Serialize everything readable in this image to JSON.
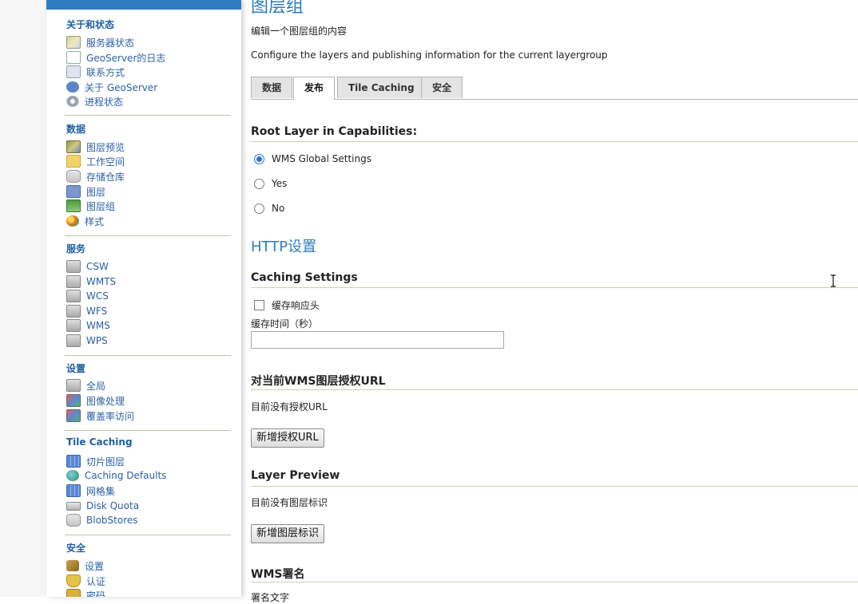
{
  "sidebar": {
    "sections": [
      {
        "title": "关于和状态",
        "items": [
          {
            "label": "服务器状态",
            "icon": "chart-icon"
          },
          {
            "label": "GeoServer的日志",
            "icon": "document-icon"
          },
          {
            "label": "联系方式",
            "icon": "contact-card-icon"
          },
          {
            "label": "关于 GeoServer",
            "icon": "help-icon"
          },
          {
            "label": "进程状态",
            "icon": "gear-icon"
          }
        ]
      },
      {
        "title": "数据",
        "items": [
          {
            "label": "图层预览",
            "icon": "map-preview-icon"
          },
          {
            "label": "工作空间",
            "icon": "folder-icon"
          },
          {
            "label": "存储仓库",
            "icon": "database-icon"
          },
          {
            "label": "图层",
            "icon": "layer-icon"
          },
          {
            "label": "图层组",
            "icon": "layer-group-icon"
          },
          {
            "label": "样式",
            "icon": "style-palette-icon"
          }
        ]
      },
      {
        "title": "服务",
        "items": [
          {
            "label": "CSW",
            "icon": "server-icon"
          },
          {
            "label": "WMTS",
            "icon": "server-icon"
          },
          {
            "label": "WCS",
            "icon": "server-icon"
          },
          {
            "label": "WFS",
            "icon": "server-icon"
          },
          {
            "label": "WMS",
            "icon": "server-icon"
          },
          {
            "label": "WPS",
            "icon": "server-icon"
          }
        ]
      },
      {
        "title": "设置",
        "items": [
          {
            "label": "全局",
            "icon": "server-icon"
          },
          {
            "label": "图像处理",
            "icon": "image-processing-icon"
          },
          {
            "label": "覆盖率访问",
            "icon": "image-processing-icon"
          }
        ]
      },
      {
        "title": "Tile Caching",
        "items": [
          {
            "label": "切片图层",
            "icon": "grid-icon"
          },
          {
            "label": "Caching Defaults",
            "icon": "globe-icon"
          },
          {
            "label": "网格集",
            "icon": "grid-icon"
          },
          {
            "label": "Disk Quota",
            "icon": "disk-icon"
          },
          {
            "label": "BlobStores",
            "icon": "database-icon"
          }
        ]
      },
      {
        "title": "安全",
        "items": [
          {
            "label": "设置",
            "icon": "key-icon"
          },
          {
            "label": "认证",
            "icon": "shield-icon"
          },
          {
            "label": "密码",
            "icon": "lock-icon"
          }
        ]
      }
    ]
  },
  "main": {
    "title": "图层组",
    "subtitle_cn": "编辑一个图层组的内容",
    "subtitle_en": "Configure the layers and publishing information for the current layergroup",
    "tabs": [
      {
        "label": "数据",
        "active": false
      },
      {
        "label": "发布",
        "active": true
      },
      {
        "label": "Tile Caching",
        "active": false
      },
      {
        "label": "安全",
        "active": false
      }
    ],
    "root_layer": {
      "heading": "Root Layer in Capabilities:",
      "options": [
        {
          "label": "WMS Global Settings",
          "checked": true
        },
        {
          "label": "Yes",
          "checked": false
        },
        {
          "label": "No",
          "checked": false
        }
      ]
    },
    "http": {
      "title": "HTTP设置",
      "caching_heading": "Caching Settings",
      "cache_checkbox_label": "缓存响应头",
      "cache_time_label": "缓存时间（秒）",
      "cache_time_value": ""
    },
    "auth_url": {
      "heading": "对当前WMS图层授权URL",
      "empty_text": "目前没有授权URL",
      "add_button": "新增授权URL"
    },
    "layer_preview": {
      "heading": "Layer Preview",
      "empty_text": "目前没有图层标识",
      "add_button": "新增图层标识"
    },
    "wms_attribution": {
      "heading": "WMS署名",
      "label": "署名文字"
    }
  },
  "colors": {
    "accent": "#2e7cbf",
    "link": "#2a5fa5",
    "rule": "#c7d6a8"
  }
}
